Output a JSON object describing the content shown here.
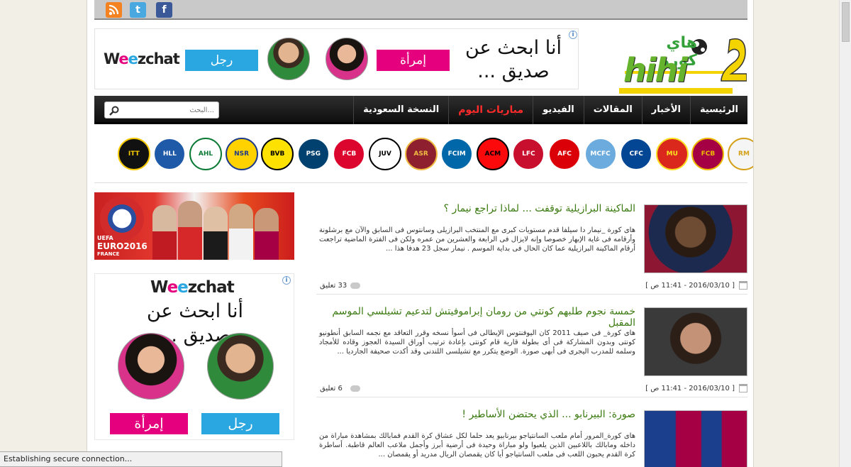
{
  "social": {
    "rss": "rss-icon",
    "twitter_glyph": "t",
    "facebook_glyph": "f"
  },
  "ad_banner": {
    "brand_w": "W",
    "brand_e1": "e",
    "brand_e2": "e",
    "brand_rest": "zchat",
    "man_label": "رجل",
    "woman_label": "إمرأة",
    "headline_1": "أنا ابحث عن",
    "headline_2": "صديق ..."
  },
  "logo": {
    "arabic": "هاي كورة",
    "latin": "hihi",
    "number": "2"
  },
  "nav": {
    "items": [
      "الرئيسية",
      "الأخبار",
      "المقالات",
      "الفيديو",
      "مباريات اليوم",
      "النسخة السعودية"
    ],
    "search_placeholder": "البحث..."
  },
  "clubs": [
    {
      "name": "real-madrid",
      "color": "#f5f5f5",
      "fg": "#d4a017",
      "abbr": "RM"
    },
    {
      "name": "barcelona",
      "color": "#a50044",
      "fg": "#edbb00",
      "abbr": "FCB"
    },
    {
      "name": "manchester-united",
      "color": "#da291c",
      "fg": "#fbe122",
      "abbr": "MU"
    },
    {
      "name": "chelsea",
      "color": "#034694",
      "fg": "#fff",
      "abbr": "CFC"
    },
    {
      "name": "manchester-city",
      "color": "#6cabdd",
      "fg": "#fff",
      "abbr": "MCFC"
    },
    {
      "name": "arsenal",
      "color": "#db0007",
      "fg": "#fff",
      "abbr": "AFC"
    },
    {
      "name": "liverpool",
      "color": "#c8102e",
      "fg": "#fff",
      "abbr": "LFC"
    },
    {
      "name": "ac-milan",
      "color": "#fb090b",
      "fg": "#000",
      "abbr": "ACM"
    },
    {
      "name": "inter",
      "color": "#0068a8",
      "fg": "#fff",
      "abbr": "FCIM"
    },
    {
      "name": "roma",
      "color": "#8e1f2f",
      "fg": "#f0bc42",
      "abbr": "ASR"
    },
    {
      "name": "juventus",
      "color": "#ffffff",
      "fg": "#000",
      "abbr": "JUV"
    },
    {
      "name": "bayern",
      "color": "#dc052d",
      "fg": "#fff",
      "abbr": "FCB"
    },
    {
      "name": "psg",
      "color": "#004170",
      "fg": "#fff",
      "abbr": "PSG"
    },
    {
      "name": "dortmund",
      "color": "#fde100",
      "fg": "#000",
      "abbr": "BVB"
    },
    {
      "name": "al-nassr",
      "color": "#ffd200",
      "fg": "#1e3a8a",
      "abbr": "NSR"
    },
    {
      "name": "al-ahli",
      "color": "#ffffff",
      "fg": "#0a7a35",
      "abbr": "AHL"
    },
    {
      "name": "al-hilal",
      "color": "#1e5aa8",
      "fg": "#fff",
      "abbr": "HLL"
    },
    {
      "name": "al-ittihad",
      "color": "#111",
      "fg": "#f6c900",
      "abbr": "ITT"
    }
  ],
  "sidebar": {
    "euro_line1": "UEFA",
    "euro_line2": "EURO2016",
    "euro_line3": "FRANCE"
  },
  "posts": [
    {
      "title": "الماكينة البرازيلية توقفت ... لماذا تراجع نيمار ؟",
      "excerpt": "هاى كورة _نيمار دا سيلفا قدم مستويات كبرى مع المنتخب البرازيلى وسانتوس فى السابق والآن مع برشلونة وأرقامه فى غاية الإبهار خصوصا وإنه لايزال فى الرابعة والعشرين من عمره ولكن فى الفترة الماضية تراجعت أرقام الماكينة البرازيلية عما كان الحال فى بداية الموسم . نيمار سجل 23 هدفا هذا ...",
      "date": "[ 2016/03/10 - 11:41 ص ]",
      "comments": "33 تعليق"
    },
    {
      "title": "خمسة نجوم طلبهم كونتي من رومان إبراموفيتش لتدعيم تشيلسي الموسم المقبل",
      "excerpt": "هاى كورة_ فى صيف 2011 كان اليوفنتوس الإيطالى فى أسوأ نسخه وقرر التعاقد مع نجمه السابق أنطونيو كونتى وبدون المشاركة فى أى بطولة قارية قام كونتى بإعادة ترتيب أوراق السيدة العجوز وقاده للأمجاد وسلمه للمدرب اليجرى فى أبهى صورة. الوضع يتكرر مع تشيلسى اللندنى وقد أكدت صحيفة الجارديا ...",
      "date": "[ 2016/03/10 - 11:41 ص ]",
      "comments": "6 تعليق"
    },
    {
      "title": "صورة: البيرنابو ... الذي يحتضن الأساطير !",
      "excerpt": "هاى كورة_المرور أمام ملعب السانتياجو بيرنابيو يعد حلما لكل عشاق كرة القدم فمابالك بمشاهدة مباراة من داخله ومابالك باللاعبين الذين يلعبوا ولو مباراة وحيدة فى أرضية أبرز وأجمل ملاعب العالم قاطبة. أساطرة كرة القدم يحبون اللعب فى ملعب السانتياجو أيا كان يقمصان الريال مدريد أو يقمصان ...",
      "date": "",
      "comments": ""
    }
  ],
  "statusbar": {
    "text": "Establishing secure connection..."
  }
}
